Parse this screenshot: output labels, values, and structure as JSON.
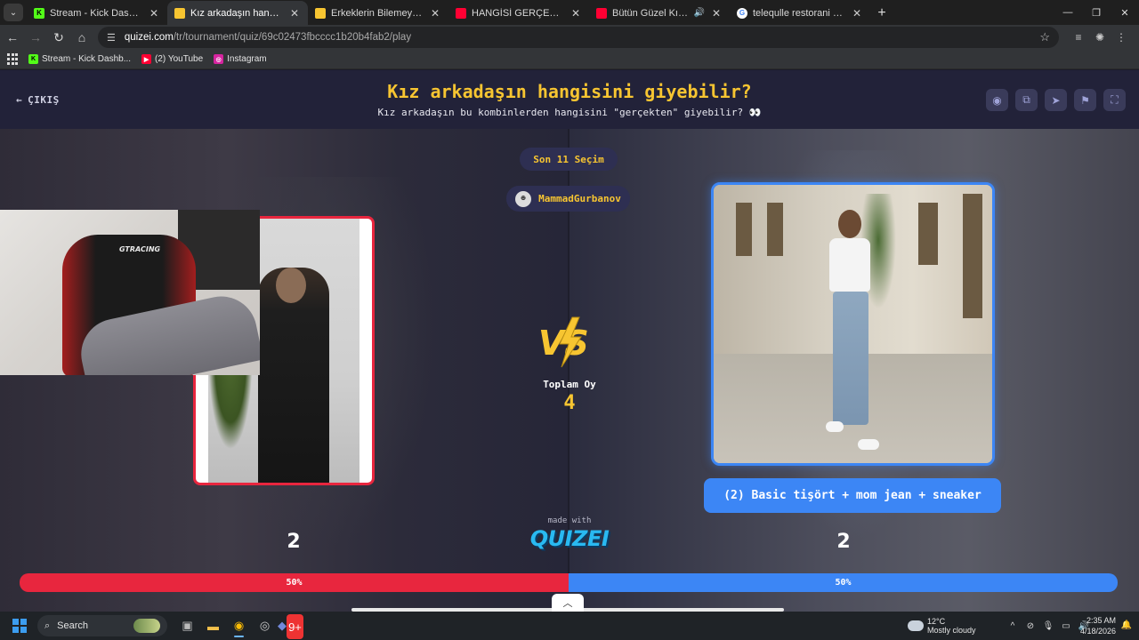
{
  "browser": {
    "tabs": [
      {
        "title": "Stream - Kick Dashboard",
        "favicon_color": "#53fc18",
        "favicon_glyph": "K"
      },
      {
        "title": "Kız arkadaşın hangisini giyebilir",
        "favicon_color": "#f7c531",
        "favicon_glyph": "",
        "active": true
      },
      {
        "title": "Erkeklerin Bilemeyeceği Şeyler",
        "favicon_color": "#f7c531",
        "favicon_glyph": ""
      },
      {
        "title": "HANGİSİ GERÇEK ESKİ SEVGİLİ",
        "favicon_color": "#ff0033",
        "favicon_glyph": ""
      },
      {
        "title": "Bütün Güzel Kızlar Bana Bak",
        "favicon_color": "#ff0033",
        "favicon_glyph": "",
        "audio": true
      },
      {
        "title": "telequlle restorani - Google'da",
        "favicon_color": "#ffffff",
        "favicon_glyph": "G"
      }
    ],
    "new_tab_label": "+",
    "url": {
      "host": "quizei.com",
      "path": "/tr/tournament/quiz/69c02473fbcccc1b20b4fab2/play"
    },
    "bookmarks": [
      {
        "label": "Stream - Kick Dashb...",
        "favicon_color": "#53fc18",
        "favicon_glyph": "K"
      },
      {
        "label": "(2) YouTube",
        "favicon_color": "#ff0033",
        "favicon_glyph": "▶"
      },
      {
        "label": "Instagram",
        "favicon_color": "#d6249f",
        "favicon_glyph": "◎"
      }
    ]
  },
  "quiz": {
    "exit_label": "ÇIKIŞ",
    "title": "Kız arkadaşın hangisini giyebilir?",
    "subtitle": "Kız arkadaşın bu kombinlerden hangisini \"gerçekten\" giyebilir? 👀",
    "header_icons": [
      "eye-icon",
      "share-icon",
      "send-icon",
      "flag-icon",
      "fullscreen-icon"
    ],
    "round_label": "Son 11 Seçim",
    "username": "MammadGurbanov",
    "vs_label": "VS",
    "total_votes_label": "Toplam Oy",
    "total_votes": "4",
    "left": {
      "votes": "2",
      "percent_label": "50%",
      "percent": 50,
      "color": "#e8263e"
    },
    "right": {
      "votes": "2",
      "percent_label": "50%",
      "percent": 50,
      "color": "#3c86f5",
      "caption": "(2) Basic tişört + mom jean + sneaker"
    },
    "made_with": "made with",
    "brand": "QUIZEI"
  },
  "webcam": {
    "chair_brand": "GTRACING"
  },
  "taskbar": {
    "search_placeholder": "Search",
    "weather_temp": "12°C",
    "weather_desc": "Mostly cloudy",
    "time": "2:35 AM",
    "date": "4/18/2026",
    "discord_badge": "9+"
  }
}
